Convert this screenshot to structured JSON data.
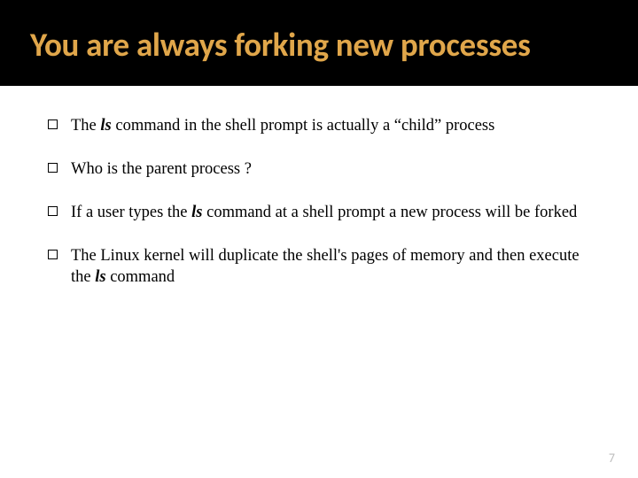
{
  "title": "You are always forking new processes",
  "bullets": [
    {
      "pre": "The ",
      "cmd": "ls",
      "post": " command in the shell prompt is actually a “child” process"
    },
    {
      "pre": "Who is the parent process ?",
      "cmd": "",
      "post": ""
    },
    {
      "pre": "If a user types the ",
      "cmd": "ls",
      "post": " command at a shell prompt a new process will be forked"
    },
    {
      "pre": "The Linux kernel will duplicate the shell's pages of memory and then execute the ",
      "cmd": "ls",
      "post": " command"
    }
  ],
  "page_number": "7"
}
